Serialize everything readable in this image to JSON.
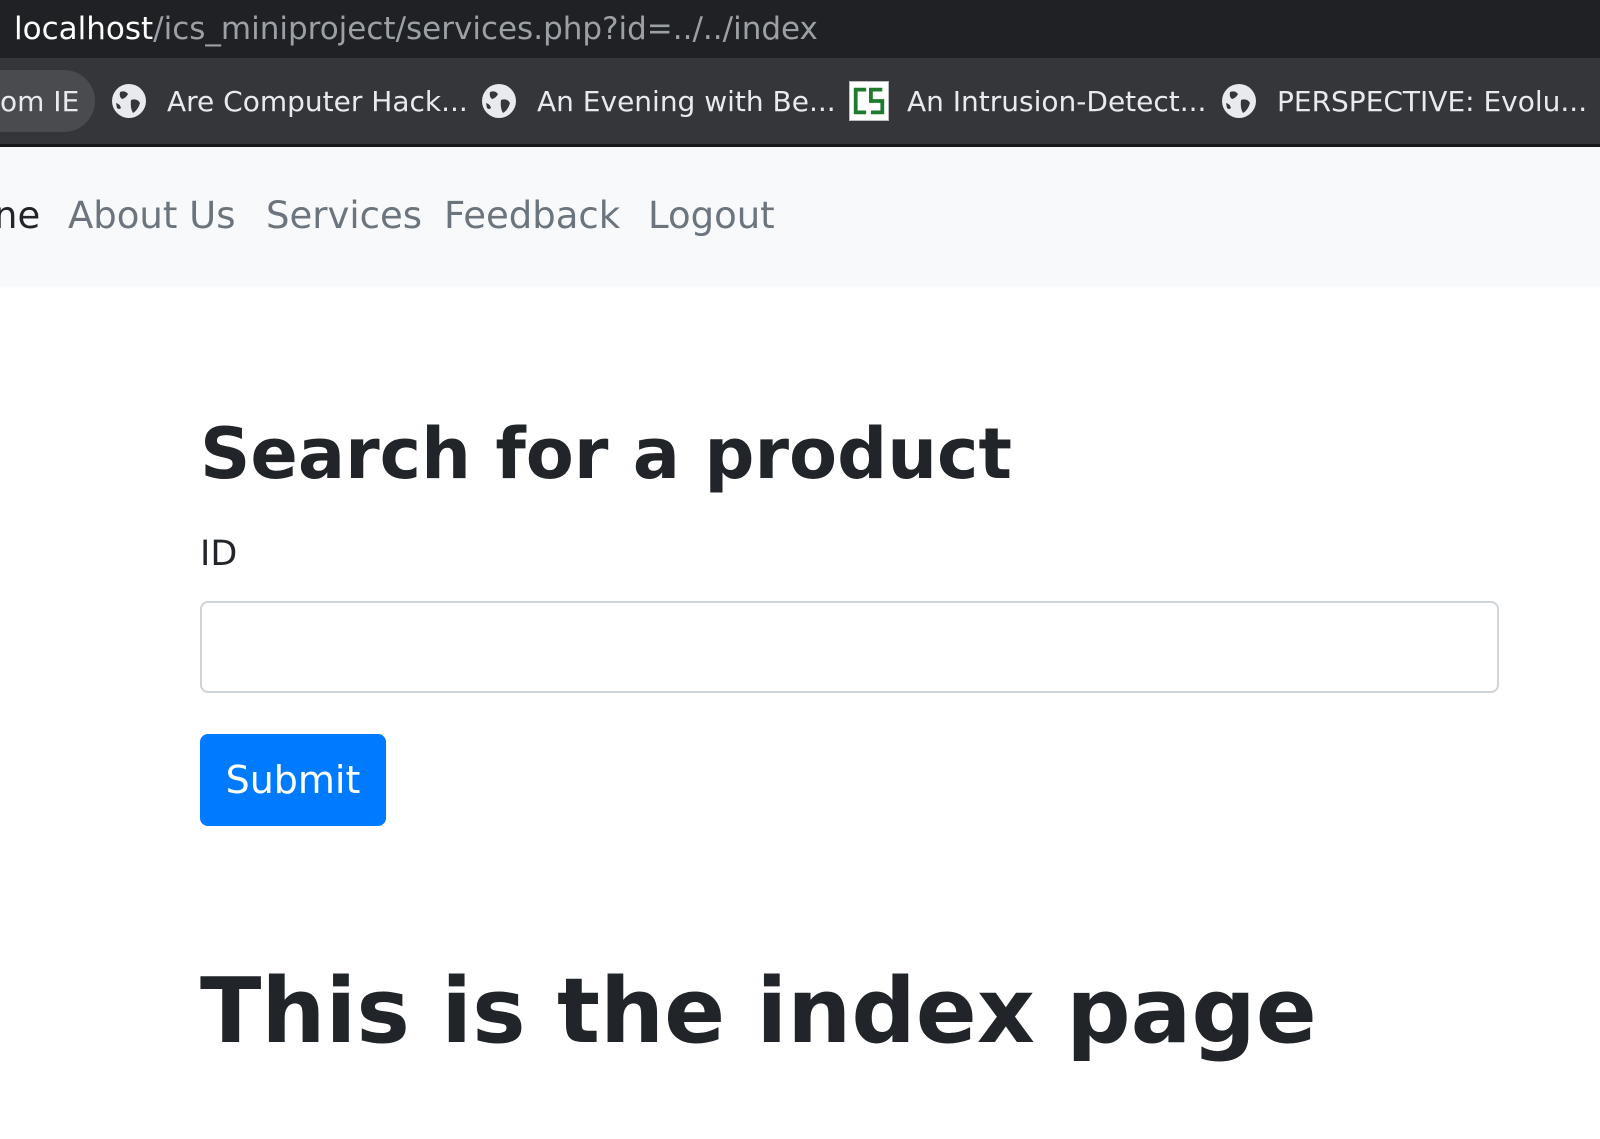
{
  "browser": {
    "url_host": "localhost",
    "url_path": "/ics_miniproject/services.php?id=../../index"
  },
  "bookmarks": [
    {
      "label": "om IE",
      "icon": "none"
    },
    {
      "label": "Are Computer Hack...",
      "icon": "globe-icon"
    },
    {
      "label": "An Evening with Be...",
      "icon": "globe-icon"
    },
    {
      "label": "An Intrusion-Detect...",
      "icon": "cs-icon"
    },
    {
      "label": "PERSPECTIVE: Evolu...",
      "icon": "globe-icon"
    }
  ],
  "nav": {
    "items": [
      "ne",
      "About Us",
      "Services",
      "Feedback",
      "Logout"
    ]
  },
  "form": {
    "heading": "Search for a product",
    "id_label": "ID",
    "id_value": "",
    "submit_label": "Submit"
  },
  "content": {
    "heading": "This is the index page"
  },
  "colors": {
    "primary": "#007bff",
    "navbar_bg": "#f8f9fa",
    "nav_link": "#6c757d",
    "text": "#212529"
  }
}
